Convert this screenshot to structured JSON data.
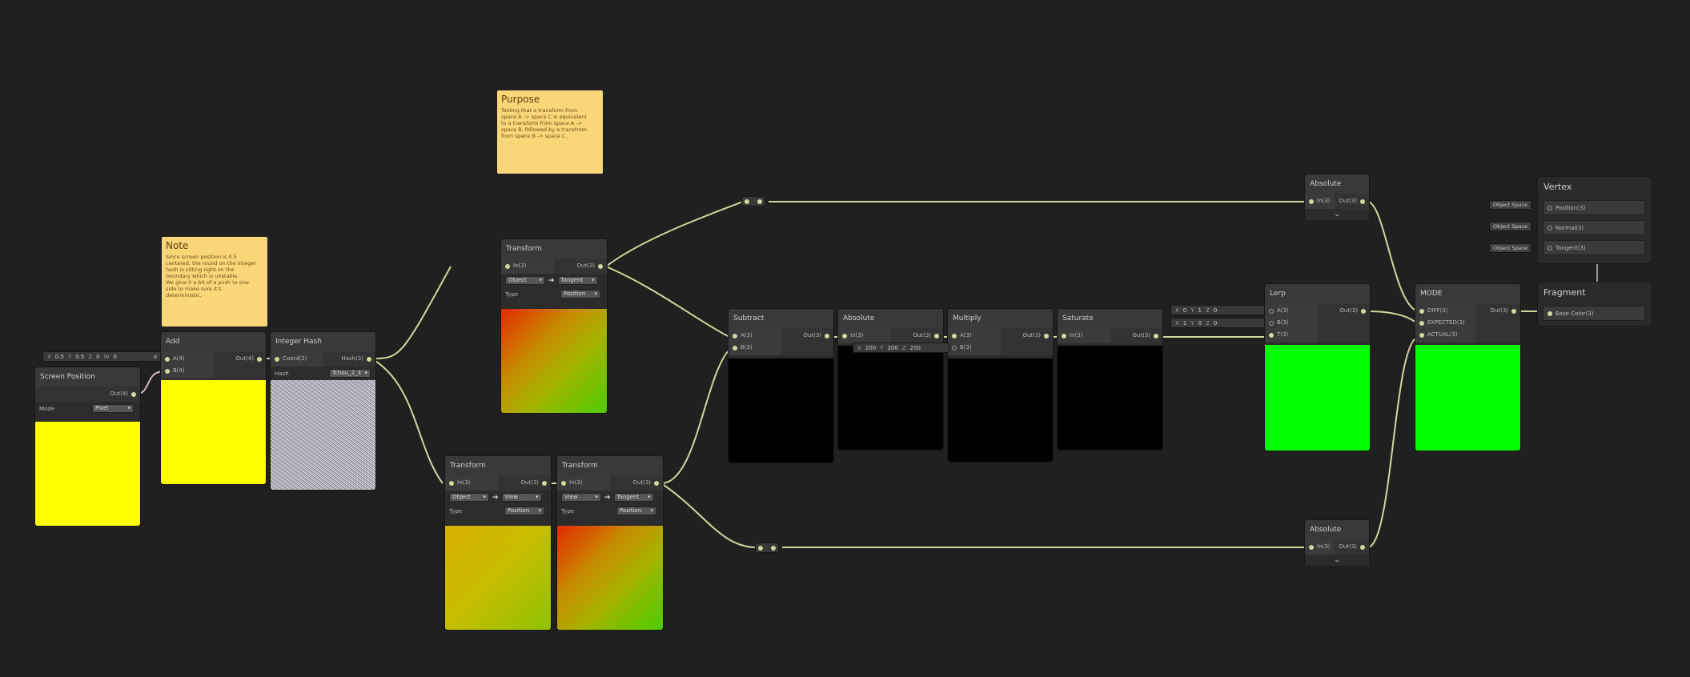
{
  "colors": {
    "background": "#202020",
    "wire": "#d4d79a",
    "wire_pink": "#d8b3c6",
    "sticky": "#f9d779",
    "preview_green": "#00ff00",
    "preview_yellow": "#ffff00",
    "preview_black": "#000000"
  },
  "sticky_notes": {
    "purpose": {
      "title": "Purpose",
      "body": "Testing that a transform from\nspace A -> space C is equivalent\nto a transform from space A ->\nspace B, followed by a transfrom\nfrom space B -> space C."
    },
    "note": {
      "title": "Note",
      "body": "Since screen position is 0.5\ncentered, the round on the integer\nhash is sitting right on the\nboundary which is unstable.\nWe give it a bit of a push to one\nside to make sure it's\ndeterministic."
    }
  },
  "screen_position": {
    "inline": {
      "x_label": "X",
      "x": "0.5",
      "y_label": "Y",
      "y": "0.5",
      "z_label": "Z",
      "z": "0",
      "w_label": "W",
      "w": "0"
    },
    "title": "Screen Position",
    "out": "Out(4)",
    "mode_label": "Mode",
    "mode_value": "Pixel"
  },
  "add": {
    "title": "Add",
    "in_a": "A(4)",
    "in_b": "B(4)",
    "out": "Out(4)"
  },
  "integer_hash": {
    "title": "Integer Hash",
    "in": "Coord(2)",
    "out": "Hash(3)",
    "hash_label": "Hash",
    "hash_value": "Tchou_2_3"
  },
  "transform_top": {
    "title": "Transform",
    "in": "In(3)",
    "out": "Out(3)",
    "from": "Object",
    "to": "Tangent",
    "type_label": "Type",
    "type_value": "Position"
  },
  "transform_b1": {
    "title": "Transform",
    "in": "In(3)",
    "out": "Out(3)",
    "from": "Object",
    "to": "View",
    "type_label": "Type",
    "type_value": "Position"
  },
  "transform_b2": {
    "title": "Transform",
    "in": "In(3)",
    "out": "Out(3)",
    "from": "View",
    "to": "Tangent",
    "type_label": "Type",
    "type_value": "Position"
  },
  "subtract": {
    "title": "Subtract",
    "in_a": "A(3)",
    "in_b": "B(3)",
    "out": "Out(3)"
  },
  "absolute_mid": {
    "title": "Absolute",
    "in": "In(3)",
    "out": "Out(3)"
  },
  "multiply": {
    "title": "Multiply",
    "in_a": "A(3)",
    "in_b": "B(3)",
    "out": "Out(3)",
    "inline": {
      "x_label": "X",
      "x": "200",
      "y_label": "Y",
      "y": "200",
      "z_label": "Z",
      "z": "200"
    }
  },
  "saturate": {
    "title": "Saturate",
    "in": "In(3)",
    "out": "Out(3)"
  },
  "lerp": {
    "title": "Lerp",
    "in_a": "A(3)",
    "in_b": "B(3)",
    "in_t": "T(3)",
    "out": "Out(3)",
    "inline_a": {
      "x_label": "X",
      "x": "0",
      "y_label": "Y",
      "y": "1",
      "z_label": "Z",
      "z": "0"
    },
    "inline_b": {
      "x_label": "X",
      "x": "1",
      "y_label": "Y",
      "y": "0",
      "z_label": "Z",
      "z": "0"
    }
  },
  "absolute_top": {
    "title": "Absolute",
    "in": "In(3)",
    "out": "Out(3)",
    "expand": "⌄"
  },
  "absolute_bottom": {
    "title": "Absolute",
    "in": "In(3)",
    "out": "Out(3)",
    "expand": "⌄"
  },
  "mode_node": {
    "title": "MODE",
    "in_diff": "DIFF(3)",
    "in_expected": "EXPECTED(3)",
    "in_actual": "ACTUAL(3)",
    "out": "Out(3)"
  },
  "vertex": {
    "title": "Vertex",
    "blocks": [
      {
        "label": "Position(3)",
        "space": "Object Space"
      },
      {
        "label": "Normal(3)",
        "space": "Object Space"
      },
      {
        "label": "Tangent(3)",
        "space": "Object Space"
      }
    ]
  },
  "fragment": {
    "title": "Fragment",
    "blocks": [
      {
        "label": "Base Color(3)"
      }
    ]
  }
}
